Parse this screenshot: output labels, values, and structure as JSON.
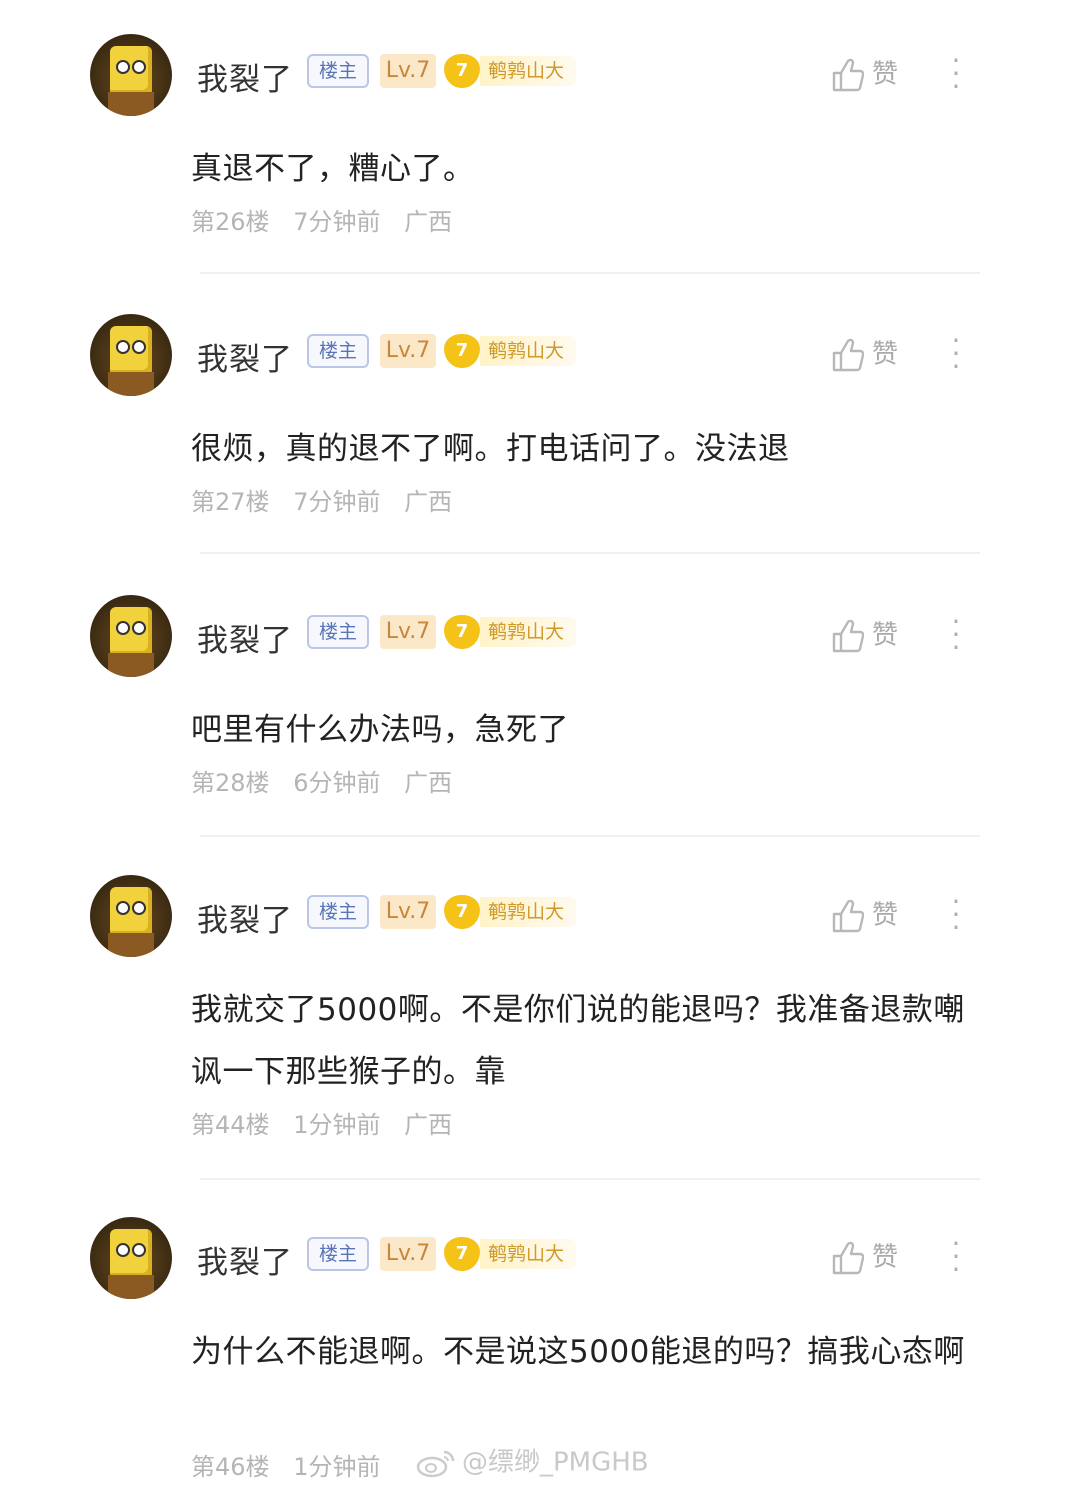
{
  "comments": [
    {
      "user": "我裂了",
      "op_tag": "楼主",
      "level": "Lv.7",
      "badge_number": "7",
      "badge_title": "鹌鹑山大",
      "like_label": "赞",
      "text": "真退不了，糟心了。",
      "floor": "第26楼",
      "time": "7分钟前",
      "location": "广西"
    },
    {
      "user": "我裂了",
      "op_tag": "楼主",
      "level": "Lv.7",
      "badge_number": "7",
      "badge_title": "鹌鹑山大",
      "like_label": "赞",
      "text": "很烦，真的退不了啊。打电话问了。没法退",
      "floor": "第27楼",
      "time": "7分钟前",
      "location": "广西"
    },
    {
      "user": "我裂了",
      "op_tag": "楼主",
      "level": "Lv.7",
      "badge_number": "7",
      "badge_title": "鹌鹑山大",
      "like_label": "赞",
      "text": "吧里有什么办法吗，急死了",
      "floor": "第28楼",
      "time": "6分钟前",
      "location": "广西"
    },
    {
      "user": "我裂了",
      "op_tag": "楼主",
      "level": "Lv.7",
      "badge_number": "7",
      "badge_title": "鹌鹑山大",
      "like_label": "赞",
      "text": "我就交了5000啊。不是你们说的能退吗？我准备退款嘲讽一下那些猴子的。靠",
      "floor": "第44楼",
      "time": "1分钟前",
      "location": "广西"
    },
    {
      "user": "我裂了",
      "op_tag": "楼主",
      "level": "Lv.7",
      "badge_number": "7",
      "badge_title": "鹌鹑山大",
      "like_label": "赞",
      "text": "为什么不能退啊。不是说这5000能退的吗？搞我心态啊",
      "floor": "第46楼",
      "time": "1分钟前",
      "location": ""
    }
  ],
  "watermark": "@缥缈_PMGHB",
  "colors": {
    "op_tag_border": "#b9c6e6",
    "level_bg": "#fbe8c9",
    "badge_gold": "#f5c318",
    "meta_text": "#b5b5b5"
  },
  "icons": {
    "like": "thumbs-up-icon",
    "more": "more-vertical-icon",
    "watermark": "weibo-logo-icon"
  }
}
